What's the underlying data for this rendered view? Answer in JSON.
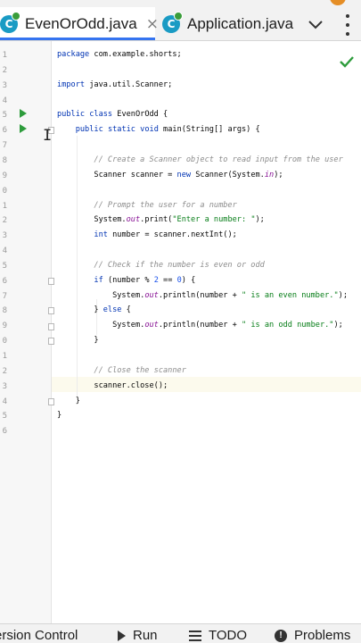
{
  "tabs": [
    {
      "label": "EvenOrOdd.java",
      "icon": "java-class-icon",
      "active": true,
      "close": "×"
    },
    {
      "label": "Application.java",
      "icon": "java-class-icon",
      "active": false
    }
  ],
  "editor": {
    "line_numbers": [
      "1",
      "2",
      "3",
      "4",
      "5",
      "6",
      "7",
      "8",
      "9",
      "0",
      "1",
      "2",
      "3",
      "4",
      "5",
      "6",
      "7",
      "8",
      "9",
      "0",
      "1",
      "2",
      "3",
      "4",
      "5",
      "6"
    ],
    "lines": [
      "package com.example.shorts;",
      "",
      "import java.util.Scanner;",
      "",
      "public class EvenOrOdd {",
      "    public static void main(String[] args) {",
      "",
      "        // Create a Scanner object to read input from the user",
      "        Scanner scanner = new Scanner(System.in);",
      "",
      "        // Prompt the user for a number",
      "        System.out.print(\"Enter a number: \");",
      "        int number = scanner.nextInt();",
      "",
      "        // Check if the number is even or odd",
      "        if (number % 2 == 0) {",
      "            System.out.println(number + \" is an even number.\");",
      "        } else {",
      "            System.out.println(number + \" is an odd number.\");",
      "        }",
      "",
      "        // Close the scanner",
      "        scanner.close();",
      "    }",
      "}",
      ""
    ],
    "inspection_status": "no-problems-check-icon"
  },
  "bottom_bar": {
    "version_control": "ersion Control",
    "run": "Run",
    "todo": "TODO",
    "problems": "Problems"
  },
  "colors": {
    "accent": "#3574f0",
    "keyword": "#0033b3",
    "string": "#067d17",
    "comment": "#8c8c8c",
    "run_green": "#2e9c3c",
    "current_line": "#fcfaed"
  }
}
